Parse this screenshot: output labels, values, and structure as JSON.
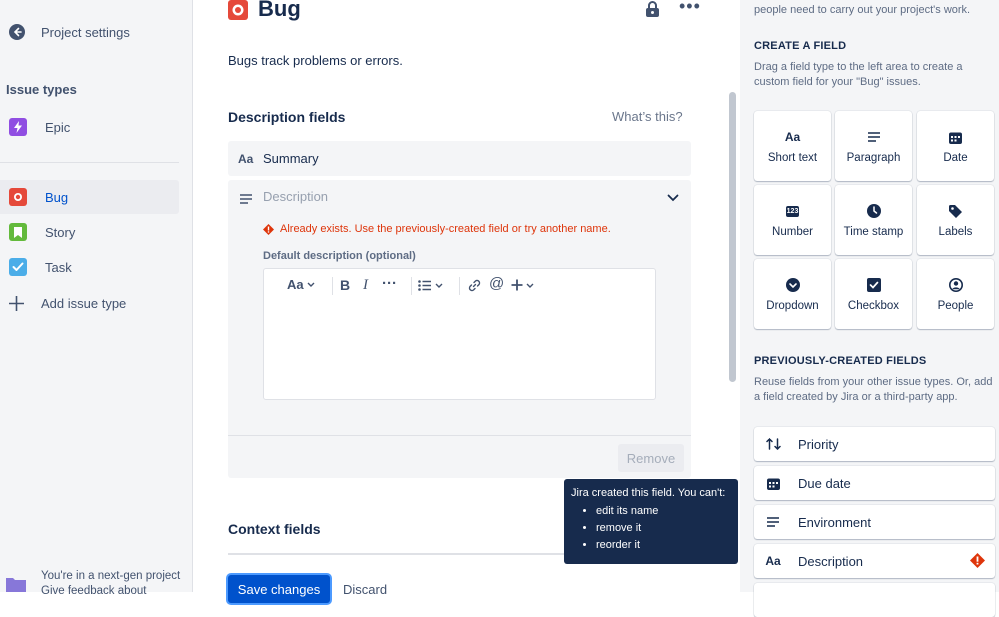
{
  "sidebar": {
    "back_label": "Project settings",
    "issue_types_heading": "Issue types",
    "epic": "Epic",
    "bug": "Bug",
    "story": "Story",
    "task": "Task",
    "add_issue_type": "Add issue type",
    "footer_line1": "You're in a next-gen project",
    "footer_line2": "Give feedback about"
  },
  "main": {
    "title": "Bug",
    "description": "Bugs track problems or errors.",
    "description_fields_heading": "Description fields",
    "whats_this": "What’s this?",
    "summary_prefix": "Aa",
    "summary_label": "Summary",
    "description_placeholder": "Description",
    "error_text": "Already exists. Use the previously-created field or try another name.",
    "default_desc_label": "Default description (optional)",
    "toolbar": {
      "text_style": "Aa",
      "bold": "B",
      "italic": "I",
      "more": "···"
    },
    "remove_label": "Remove",
    "context_fields_heading": "Context fields",
    "save_label": "Save changes",
    "discard_label": "Discard"
  },
  "tooltip": {
    "heading": "Jira created this field. You can't:",
    "items": [
      "edit its name",
      "remove it",
      "reorder it"
    ]
  },
  "panel": {
    "top_text": "people need to carry out your project's work.",
    "create_heading": "CREATE A FIELD",
    "create_help": "Drag a field type to the left area to create a custom field for your \"Bug\" issues.",
    "field_types": [
      "Short text",
      "Paragraph",
      "Date",
      "Number",
      "Time stamp",
      "Labels",
      "Dropdown",
      "Checkbox",
      "People"
    ],
    "short_text_icon_text": "Aa",
    "number_icon_text": "123",
    "prev_heading": "PREVIOUSLY-CREATED FIELDS",
    "prev_help": "Reuse fields from your other issue types. Or, add a field created by Jira or a third-party app.",
    "prev_fields": [
      "Priority",
      "Due date",
      "Environment",
      "Description"
    ],
    "description_icon_text": "Aa"
  },
  "colors": {
    "bug": "#e5493a",
    "story": "#63ba3c",
    "task": "#4bade8",
    "epic": "#904ee2",
    "link": "#0052cc",
    "error": "#de350b",
    "primary": "#0052cc",
    "tooltip_bg": "#172b4d"
  }
}
